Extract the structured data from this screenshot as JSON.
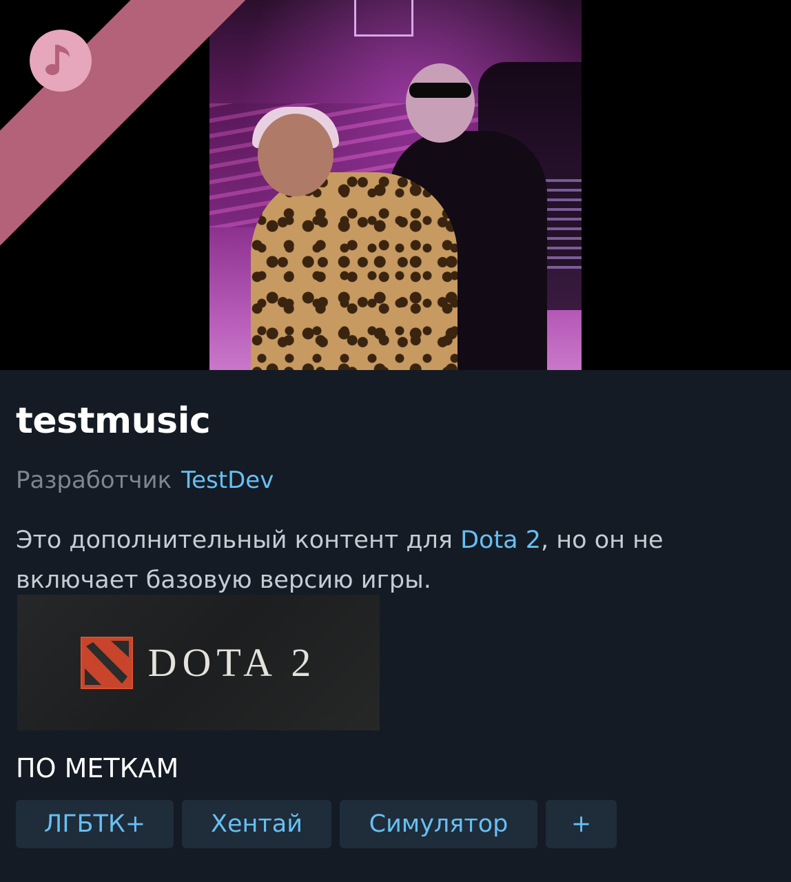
{
  "product": {
    "title": "testmusic",
    "developer_label": "Разработчик",
    "developer_name": "TestDev",
    "description_before": "Это дополнительный контент для ",
    "description_link": "Dota 2",
    "description_after": ", но он не включает базовую версию игры.",
    "base_game_logo_text": "DOTA 2"
  },
  "ribbon": {
    "icon": "music-note-icon",
    "color": "#b4627a"
  },
  "tags_section": {
    "title": "ПО МЕТКАМ",
    "tags": [
      "ЛГБТК+",
      "Хентай",
      "Симулятор",
      "+"
    ]
  },
  "colors": {
    "background": "#141b24",
    "link": "#66c0f4",
    "tag_background": "#1f2c3a",
    "muted_text": "#7f8690"
  }
}
